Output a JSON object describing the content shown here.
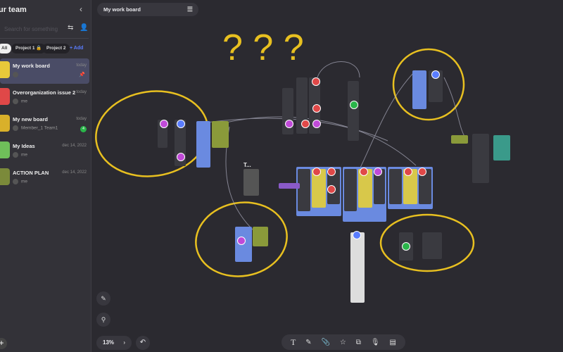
{
  "sidebar": {
    "title": "ur team",
    "search_placeholder": "Search for something",
    "chips": [
      "All",
      "Project 1 🔒",
      "Project 2"
    ],
    "add_label": "+ Add",
    "boards": [
      {
        "name": "My work board",
        "date": "today",
        "user": "",
        "thumb": "#e8c93a"
      },
      {
        "name": "Overorganization issue 2",
        "date": "today",
        "user": "me",
        "thumb": "#e04848"
      },
      {
        "name": "My new board",
        "date": "today",
        "user": "Member_1 Team1",
        "badge": "4",
        "thumb": "#d9b02a"
      },
      {
        "name": "My Ideas",
        "date": "dec 14, 2022",
        "user": "me",
        "thumb": "#6fbf5a"
      },
      {
        "name": "ACTION PLAN",
        "date": "dec 14, 2022",
        "user": "me",
        "thumb": "#7b8a3a"
      }
    ]
  },
  "topbar": {
    "board_title": "My work board"
  },
  "canvas": {
    "frame_label": "T..."
  },
  "zoom": {
    "level": "13%"
  },
  "colors": {
    "accent": "#5a7dff",
    "annotation": "#e8c020",
    "card_blue": "#6a8ae0",
    "card_olive": "#8a9a3a",
    "card_dark": "#3a3a40"
  }
}
